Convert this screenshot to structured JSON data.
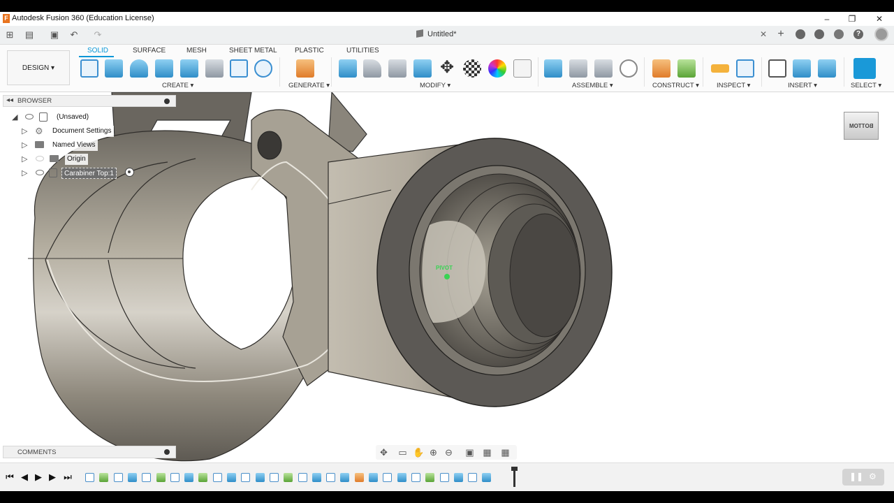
{
  "window": {
    "title": "Autodesk Fusion 360 (Education License)",
    "logo_letter": "F",
    "minimize": "–",
    "maximize": "❐",
    "close": "✕"
  },
  "quick_access": {
    "document_title": "Untitled*",
    "doc_close": "✕",
    "new_tab": "+",
    "grid_icon": "⊞",
    "file_icon": "▤",
    "save_icon": "▣",
    "undo_icon": "↶",
    "redo_icon": "↷",
    "help_label": "?"
  },
  "ribbon": {
    "workspace": "DESIGN",
    "workspace_arrow": "▾",
    "tabs": [
      "SOLID",
      "SURFACE",
      "MESH",
      "SHEET METAL",
      "PLASTIC",
      "UTILITIES"
    ],
    "active_tab": "SOLID",
    "groups": [
      {
        "label": "CREATE ▾"
      },
      {
        "label": "GENERATE ▾"
      },
      {
        "label": "MODIFY ▾"
      },
      {
        "label": "ASSEMBLE ▾"
      },
      {
        "label": "CONSTRUCT ▾"
      },
      {
        "label": "INSPECT ▾"
      },
      {
        "label": "INSERT ▾"
      },
      {
        "label": "SELECT ▾"
      }
    ],
    "move_glyph": "✥"
  },
  "browser": {
    "header": "BROWSER",
    "collapse_glyph": "◂◂",
    "root": "(Unsaved)",
    "items": [
      {
        "label": "Document Settings"
      },
      {
        "label": "Named Views"
      },
      {
        "label": "Origin"
      },
      {
        "label": "Carabiner Top:1"
      }
    ],
    "expand_glyph": "▷",
    "root_glyph": "◢"
  },
  "comments": {
    "header": "COMMENTS"
  },
  "viewport": {
    "pivot_label": "PIVOT",
    "viewcube_label": "BOTTOM",
    "pivot_color": "#39d353"
  },
  "navbar": {
    "icons": [
      "✥",
      "▭",
      "✋",
      "⊕",
      "⊖",
      "▣",
      "▦",
      "▦"
    ]
  },
  "timeline": {
    "first": "⏮",
    "prev": "◀",
    "play": "▶",
    "next": "▶",
    "last": "⏭",
    "pause_glyph": "❚❚",
    "settings_glyph": "⚙"
  },
  "colors": {
    "accent": "#0696d7",
    "body_shell": "#a39c90",
    "body_face": "#5c5955"
  }
}
